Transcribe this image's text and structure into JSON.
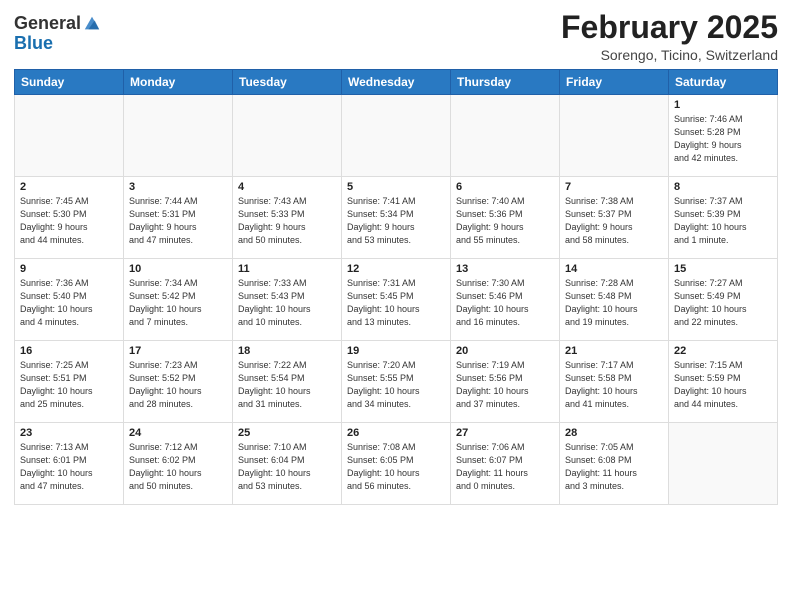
{
  "header": {
    "logo_general": "General",
    "logo_blue": "Blue",
    "month_title": "February 2025",
    "location": "Sorengo, Ticino, Switzerland"
  },
  "days_of_week": [
    "Sunday",
    "Monday",
    "Tuesday",
    "Wednesday",
    "Thursday",
    "Friday",
    "Saturday"
  ],
  "weeks": [
    [
      {
        "day": "",
        "info": ""
      },
      {
        "day": "",
        "info": ""
      },
      {
        "day": "",
        "info": ""
      },
      {
        "day": "",
        "info": ""
      },
      {
        "day": "",
        "info": ""
      },
      {
        "day": "",
        "info": ""
      },
      {
        "day": "1",
        "info": "Sunrise: 7:46 AM\nSunset: 5:28 PM\nDaylight: 9 hours\nand 42 minutes."
      }
    ],
    [
      {
        "day": "2",
        "info": "Sunrise: 7:45 AM\nSunset: 5:30 PM\nDaylight: 9 hours\nand 44 minutes."
      },
      {
        "day": "3",
        "info": "Sunrise: 7:44 AM\nSunset: 5:31 PM\nDaylight: 9 hours\nand 47 minutes."
      },
      {
        "day": "4",
        "info": "Sunrise: 7:43 AM\nSunset: 5:33 PM\nDaylight: 9 hours\nand 50 minutes."
      },
      {
        "day": "5",
        "info": "Sunrise: 7:41 AM\nSunset: 5:34 PM\nDaylight: 9 hours\nand 53 minutes."
      },
      {
        "day": "6",
        "info": "Sunrise: 7:40 AM\nSunset: 5:36 PM\nDaylight: 9 hours\nand 55 minutes."
      },
      {
        "day": "7",
        "info": "Sunrise: 7:38 AM\nSunset: 5:37 PM\nDaylight: 9 hours\nand 58 minutes."
      },
      {
        "day": "8",
        "info": "Sunrise: 7:37 AM\nSunset: 5:39 PM\nDaylight: 10 hours\nand 1 minute."
      }
    ],
    [
      {
        "day": "9",
        "info": "Sunrise: 7:36 AM\nSunset: 5:40 PM\nDaylight: 10 hours\nand 4 minutes."
      },
      {
        "day": "10",
        "info": "Sunrise: 7:34 AM\nSunset: 5:42 PM\nDaylight: 10 hours\nand 7 minutes."
      },
      {
        "day": "11",
        "info": "Sunrise: 7:33 AM\nSunset: 5:43 PM\nDaylight: 10 hours\nand 10 minutes."
      },
      {
        "day": "12",
        "info": "Sunrise: 7:31 AM\nSunset: 5:45 PM\nDaylight: 10 hours\nand 13 minutes."
      },
      {
        "day": "13",
        "info": "Sunrise: 7:30 AM\nSunset: 5:46 PM\nDaylight: 10 hours\nand 16 minutes."
      },
      {
        "day": "14",
        "info": "Sunrise: 7:28 AM\nSunset: 5:48 PM\nDaylight: 10 hours\nand 19 minutes."
      },
      {
        "day": "15",
        "info": "Sunrise: 7:27 AM\nSunset: 5:49 PM\nDaylight: 10 hours\nand 22 minutes."
      }
    ],
    [
      {
        "day": "16",
        "info": "Sunrise: 7:25 AM\nSunset: 5:51 PM\nDaylight: 10 hours\nand 25 minutes."
      },
      {
        "day": "17",
        "info": "Sunrise: 7:23 AM\nSunset: 5:52 PM\nDaylight: 10 hours\nand 28 minutes."
      },
      {
        "day": "18",
        "info": "Sunrise: 7:22 AM\nSunset: 5:54 PM\nDaylight: 10 hours\nand 31 minutes."
      },
      {
        "day": "19",
        "info": "Sunrise: 7:20 AM\nSunset: 5:55 PM\nDaylight: 10 hours\nand 34 minutes."
      },
      {
        "day": "20",
        "info": "Sunrise: 7:19 AM\nSunset: 5:56 PM\nDaylight: 10 hours\nand 37 minutes."
      },
      {
        "day": "21",
        "info": "Sunrise: 7:17 AM\nSunset: 5:58 PM\nDaylight: 10 hours\nand 41 minutes."
      },
      {
        "day": "22",
        "info": "Sunrise: 7:15 AM\nSunset: 5:59 PM\nDaylight: 10 hours\nand 44 minutes."
      }
    ],
    [
      {
        "day": "23",
        "info": "Sunrise: 7:13 AM\nSunset: 6:01 PM\nDaylight: 10 hours\nand 47 minutes."
      },
      {
        "day": "24",
        "info": "Sunrise: 7:12 AM\nSunset: 6:02 PM\nDaylight: 10 hours\nand 50 minutes."
      },
      {
        "day": "25",
        "info": "Sunrise: 7:10 AM\nSunset: 6:04 PM\nDaylight: 10 hours\nand 53 minutes."
      },
      {
        "day": "26",
        "info": "Sunrise: 7:08 AM\nSunset: 6:05 PM\nDaylight: 10 hours\nand 56 minutes."
      },
      {
        "day": "27",
        "info": "Sunrise: 7:06 AM\nSunset: 6:07 PM\nDaylight: 11 hours\nand 0 minutes."
      },
      {
        "day": "28",
        "info": "Sunrise: 7:05 AM\nSunset: 6:08 PM\nDaylight: 11 hours\nand 3 minutes."
      },
      {
        "day": "",
        "info": ""
      }
    ]
  ]
}
